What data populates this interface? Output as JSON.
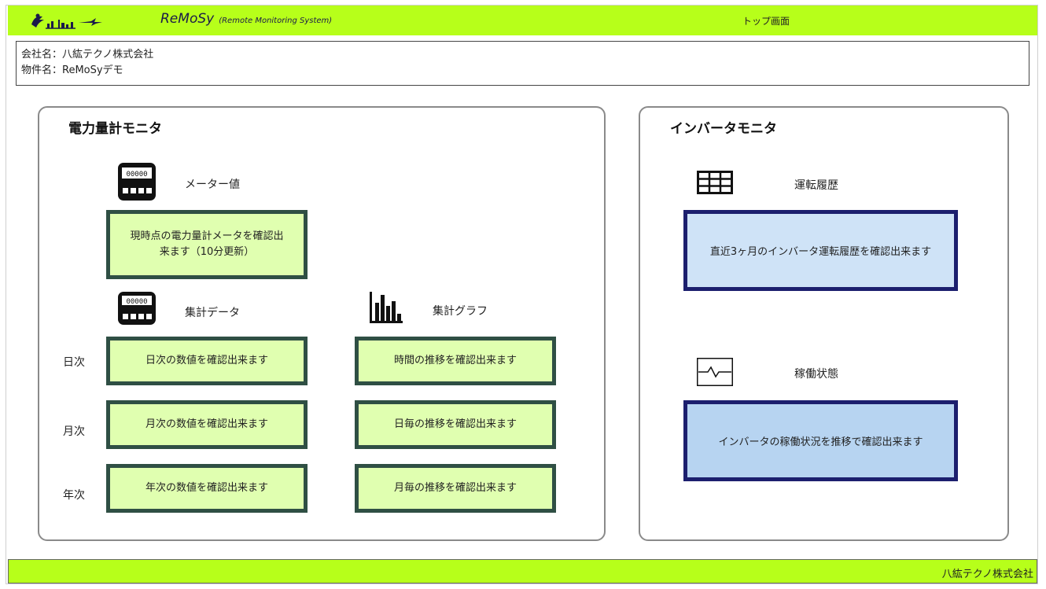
{
  "header": {
    "app_name": "ReMoSy",
    "app_subtitle": "(Remote Monitoring System)",
    "page_title": "トップ画面",
    "logo_icon": "remosy-logo-icon"
  },
  "company_info": {
    "company_line": "会社名：八紘テクノ株式会社",
    "property_line": "物件名：ReMoSyデモ"
  },
  "power_monitor": {
    "title": "電力量計モニタ",
    "meter_value": {
      "icon": "meter-icon",
      "label": "メーター値",
      "button": "現時点の電力量計メータを確認出来ます（10分更新）"
    },
    "aggregate_data": {
      "icon": "meter-icon",
      "label": "集計データ"
    },
    "aggregate_graph": {
      "icon": "bar-chart-icon",
      "label": "集計グラフ"
    },
    "rows": [
      {
        "label": "日次",
        "data_button": "日次の数値を確認出来ます",
        "graph_button": "時間の推移を確認出来ます"
      },
      {
        "label": "月次",
        "data_button": "月次の数値を確認出来ます",
        "graph_button": "日毎の推移を確認出来ます"
      },
      {
        "label": "年次",
        "data_button": "年次の数値を確認出来ます",
        "graph_button": "月毎の推移を確認出来ます"
      }
    ]
  },
  "inverter_monitor": {
    "title": "インバータモニタ",
    "history": {
      "icon": "table-grid-icon",
      "label": "運転履歴",
      "button": "直近3ヶ月のインバータ運転履歴を確認出来ます"
    },
    "status": {
      "icon": "pulse-line-icon",
      "label": "稼働状態",
      "button": "インバータの稼働状況を推移で確認出来ます"
    }
  },
  "footer": {
    "company": "八紘テクノ株式会社"
  },
  "colors": {
    "accent_green": "#b7ff1a",
    "button_green_fill": "#e0ffb0",
    "button_green_border": "#2f4f44",
    "button_blue_border": "#1c1f6e",
    "button_blue_light": "#cfe3f7",
    "button_blue_mid": "#b7d4f1"
  }
}
